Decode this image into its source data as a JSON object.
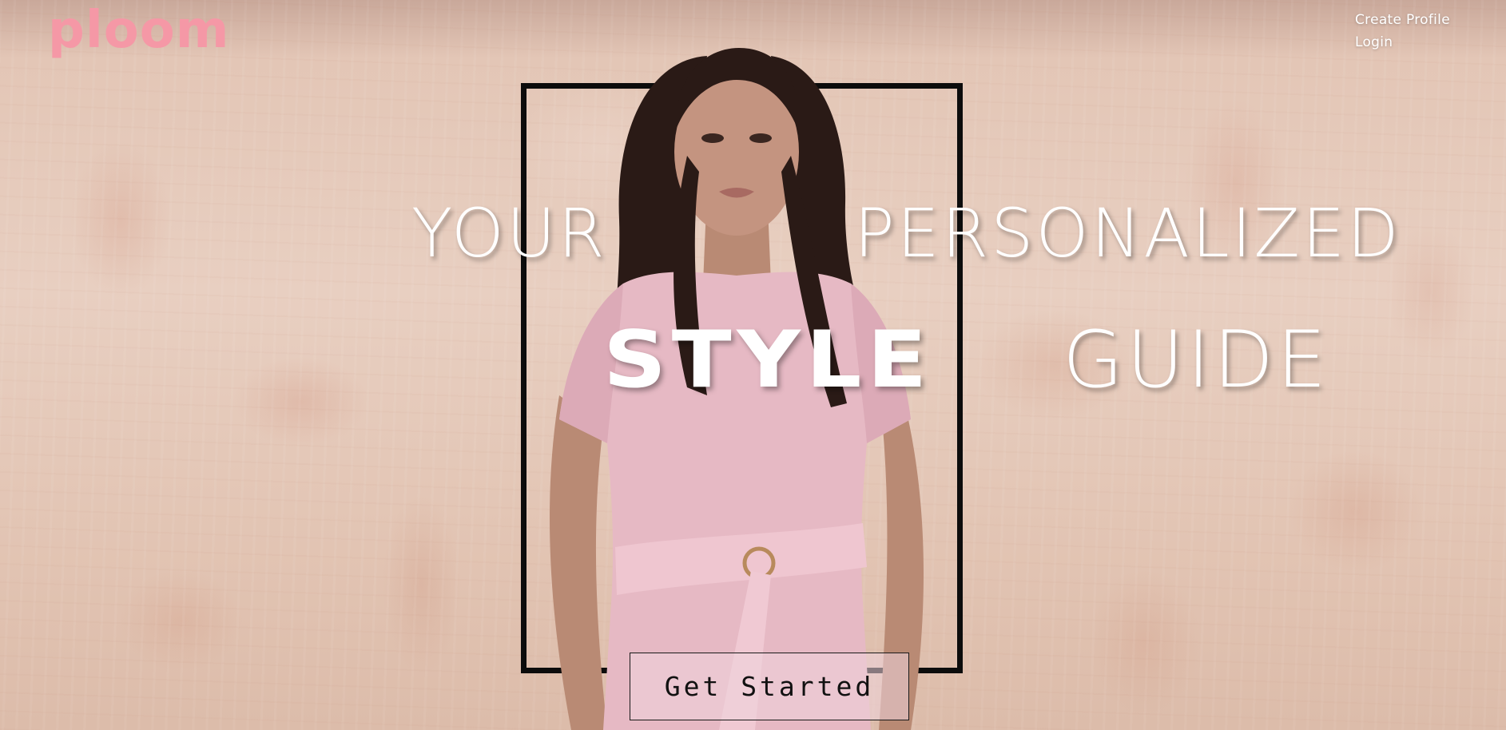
{
  "brand": {
    "logo_text": "ploom",
    "logo_color": "#f598a6"
  },
  "nav": {
    "create_profile": "Create Profile",
    "login": "Login"
  },
  "hero": {
    "headline_word_1": "YOUR",
    "headline_word_2": "PERSONALIZED",
    "headline_word_3": "STYLE",
    "headline_word_4": "GUIDE",
    "cta_label": "Get Started",
    "image_subject": "woman-in-pink-dress",
    "colors": {
      "wall": "#e5cbbd",
      "dress": "#e6b9c4",
      "hair": "#2a1a16",
      "frame": "#0c0c0c",
      "headline": "#ffffff"
    }
  }
}
